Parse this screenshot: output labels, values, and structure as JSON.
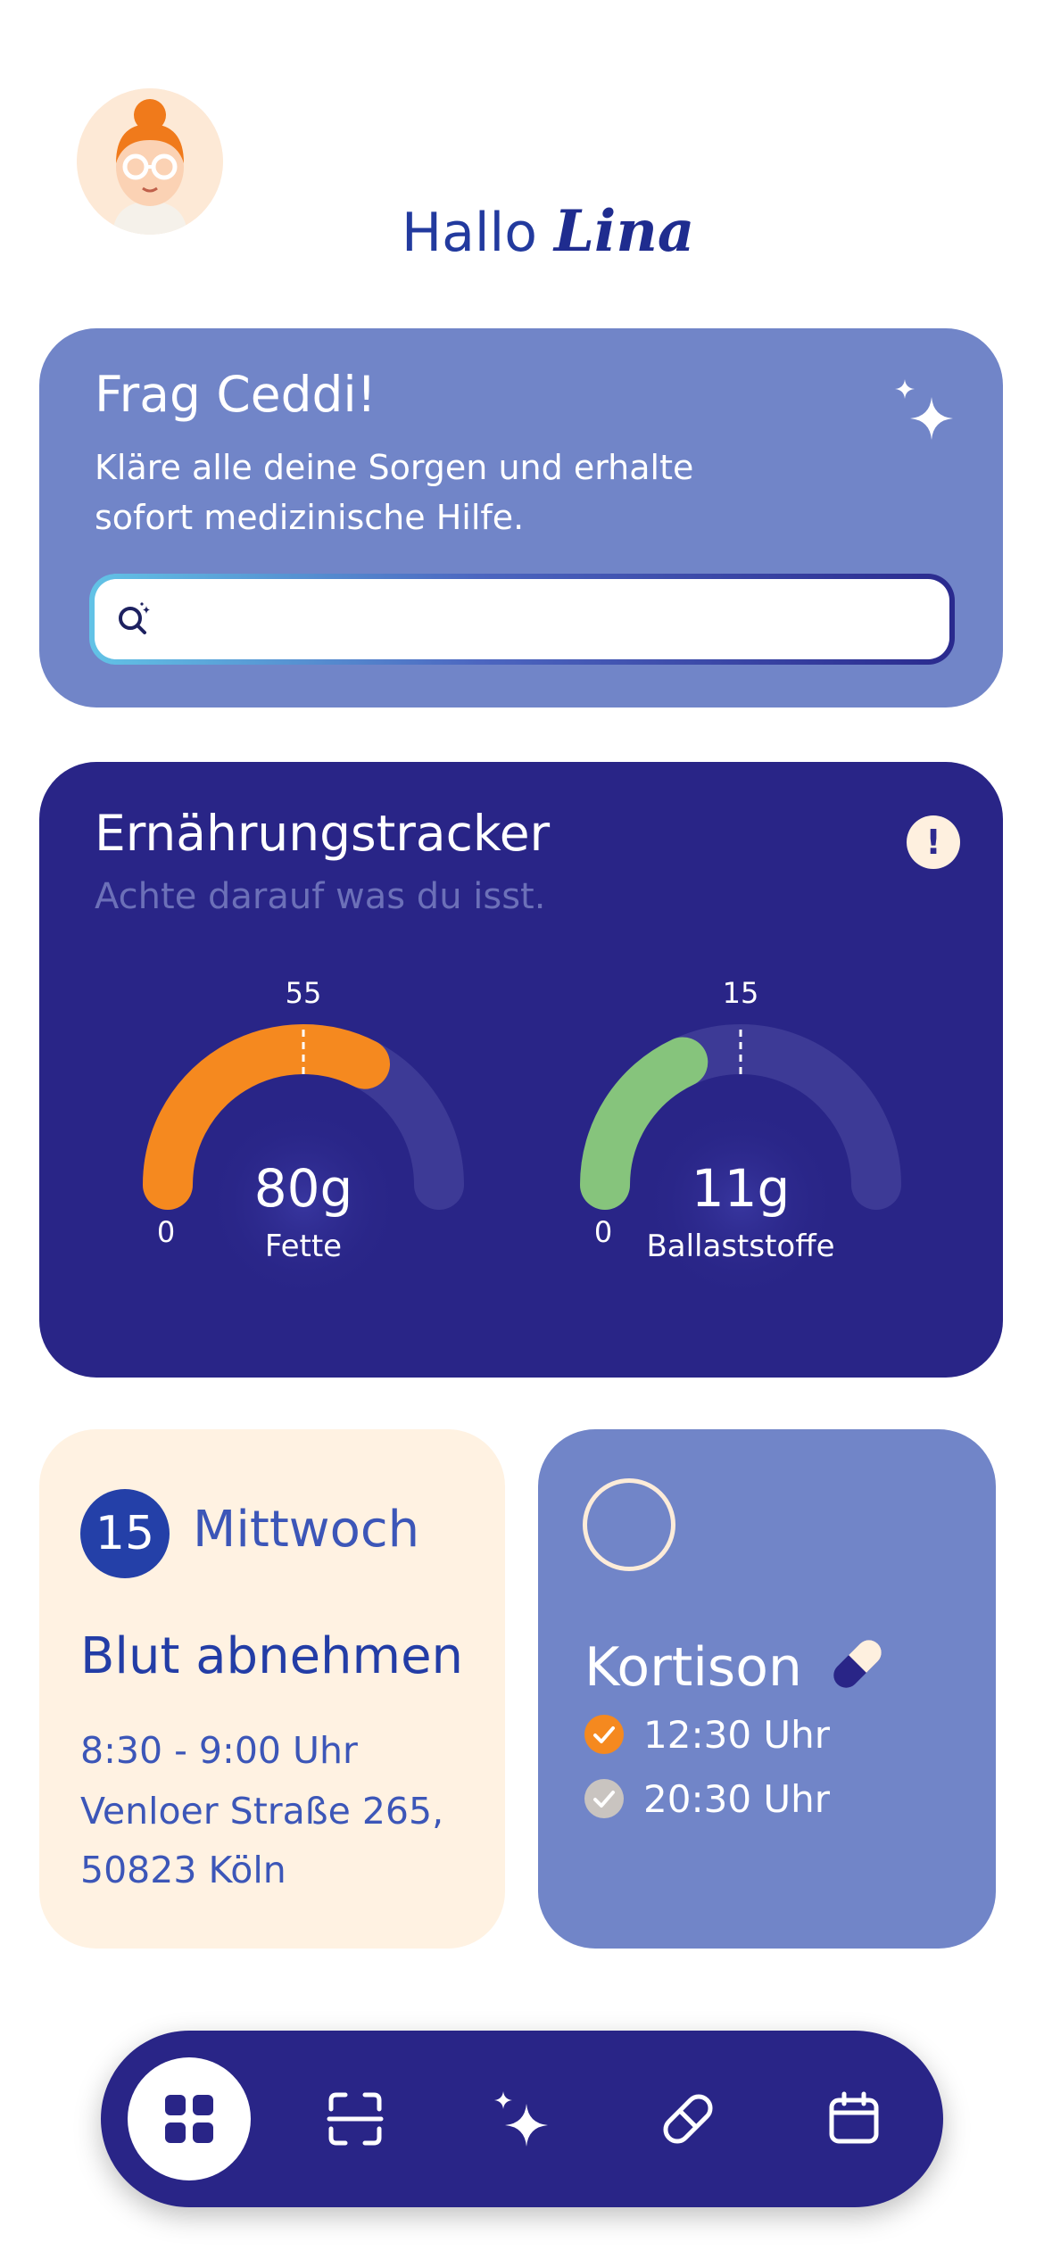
{
  "greeting": {
    "prefix": "Hallo",
    "name": "Lina"
  },
  "ask": {
    "title": "Frag Ceddi!",
    "subtitle": "Kläre alle deine Sorgen und erhalte sofort medizinische Hilfe.",
    "search_placeholder": "",
    "icon": "sparkle-icon"
  },
  "nutrition": {
    "title": "Ernährungstracker",
    "subtitle": "Achte darauf was du isst.",
    "alert": "!",
    "gauges": [
      {
        "label": "Fette",
        "value_text": "80g",
        "min_label": "0",
        "marker_label": "55",
        "fill": 0.65,
        "marker": 0.5,
        "color": "#f5891f"
      },
      {
        "label": "Ballaststoffe",
        "value_text": "11g",
        "min_label": "0",
        "marker_label": "15",
        "fill": 0.36,
        "marker": 0.5,
        "color": "#86c47c"
      }
    ]
  },
  "appointment": {
    "day": "15",
    "weekday": "Mittwoch",
    "title": "Blut abnehmen",
    "time": "8:30 - 9:00 Uhr",
    "address_line1": "Venloer Straße 265,",
    "address_line2": "50823 Köln"
  },
  "medication": {
    "name": "Kortison",
    "doses": [
      {
        "time": "12:30 Uhr",
        "status": "taken",
        "color": "#f5891f"
      },
      {
        "time": "20:30 Uhr",
        "status": "pending",
        "color": "#c9c4c0"
      }
    ]
  },
  "nav": [
    {
      "name": "dashboard",
      "icon": "grid-icon",
      "active": true
    },
    {
      "name": "scan",
      "icon": "scan-icon",
      "active": false
    },
    {
      "name": "ai-assistant",
      "icon": "sparkle-icon",
      "active": false
    },
    {
      "name": "medication",
      "icon": "pill-icon",
      "active": false
    },
    {
      "name": "calendar",
      "icon": "calendar-icon",
      "active": false
    }
  ],
  "colors": {
    "primary": "#292587",
    "accent": "#7185c8",
    "cream": "#fff2e2",
    "orange": "#f5891f",
    "green": "#86c47c"
  }
}
